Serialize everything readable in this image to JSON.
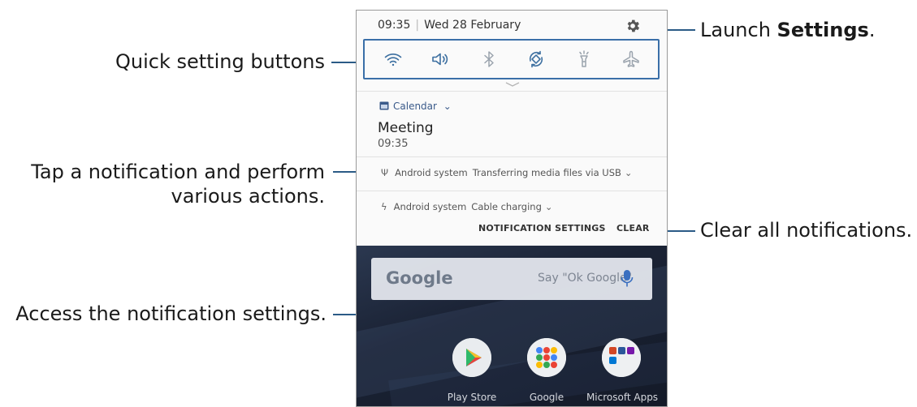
{
  "callouts": {
    "settings_prefix": "Launch ",
    "settings_bold": "Settings",
    "settings_suffix": ".",
    "quick_settings": "Quick setting buttons",
    "tap_notification_line1": "Tap a notification and perform",
    "tap_notification_line2": "various actions.",
    "clear_all": "Clear all notifications.",
    "access_settings": "Access the notification settings."
  },
  "panel": {
    "time": "09:35",
    "separator": "|",
    "date": "Wed 28 February",
    "settings_icon": "gear-icon",
    "quick_settings": [
      {
        "name": "wifi",
        "icon": "wifi-icon"
      },
      {
        "name": "sound",
        "icon": "sound-icon"
      },
      {
        "name": "bluetooth",
        "icon": "bluetooth-icon"
      },
      {
        "name": "auto-rotate",
        "icon": "auto-rotate-icon"
      },
      {
        "name": "flashlight",
        "icon": "flashlight-icon"
      },
      {
        "name": "airplane",
        "icon": "airplane-icon"
      }
    ]
  },
  "notifications": {
    "calendar": {
      "app": "Calendar",
      "chevron": "⌄",
      "title": "Meeting",
      "time": "09:35"
    },
    "usb": {
      "app": "Android system",
      "text": "Transferring media files via USB",
      "chevron": "⌄"
    },
    "charging": {
      "app": "Android system",
      "text": "Cable charging",
      "chevron": "⌄"
    },
    "actions": {
      "settings": "NOTIFICATION SETTINGS",
      "clear": "CLEAR"
    }
  },
  "home": {
    "search_logo": "Google",
    "search_hint": "Say \"Ok Google\"",
    "apps": [
      {
        "label": "Play Store"
      },
      {
        "label": "Google"
      },
      {
        "label": "Microsoft Apps"
      }
    ]
  },
  "colors": {
    "callout_line": "#2b5b86",
    "highlight_box": "#3a6fa8",
    "calendar_accent": "#3a5a8a"
  }
}
